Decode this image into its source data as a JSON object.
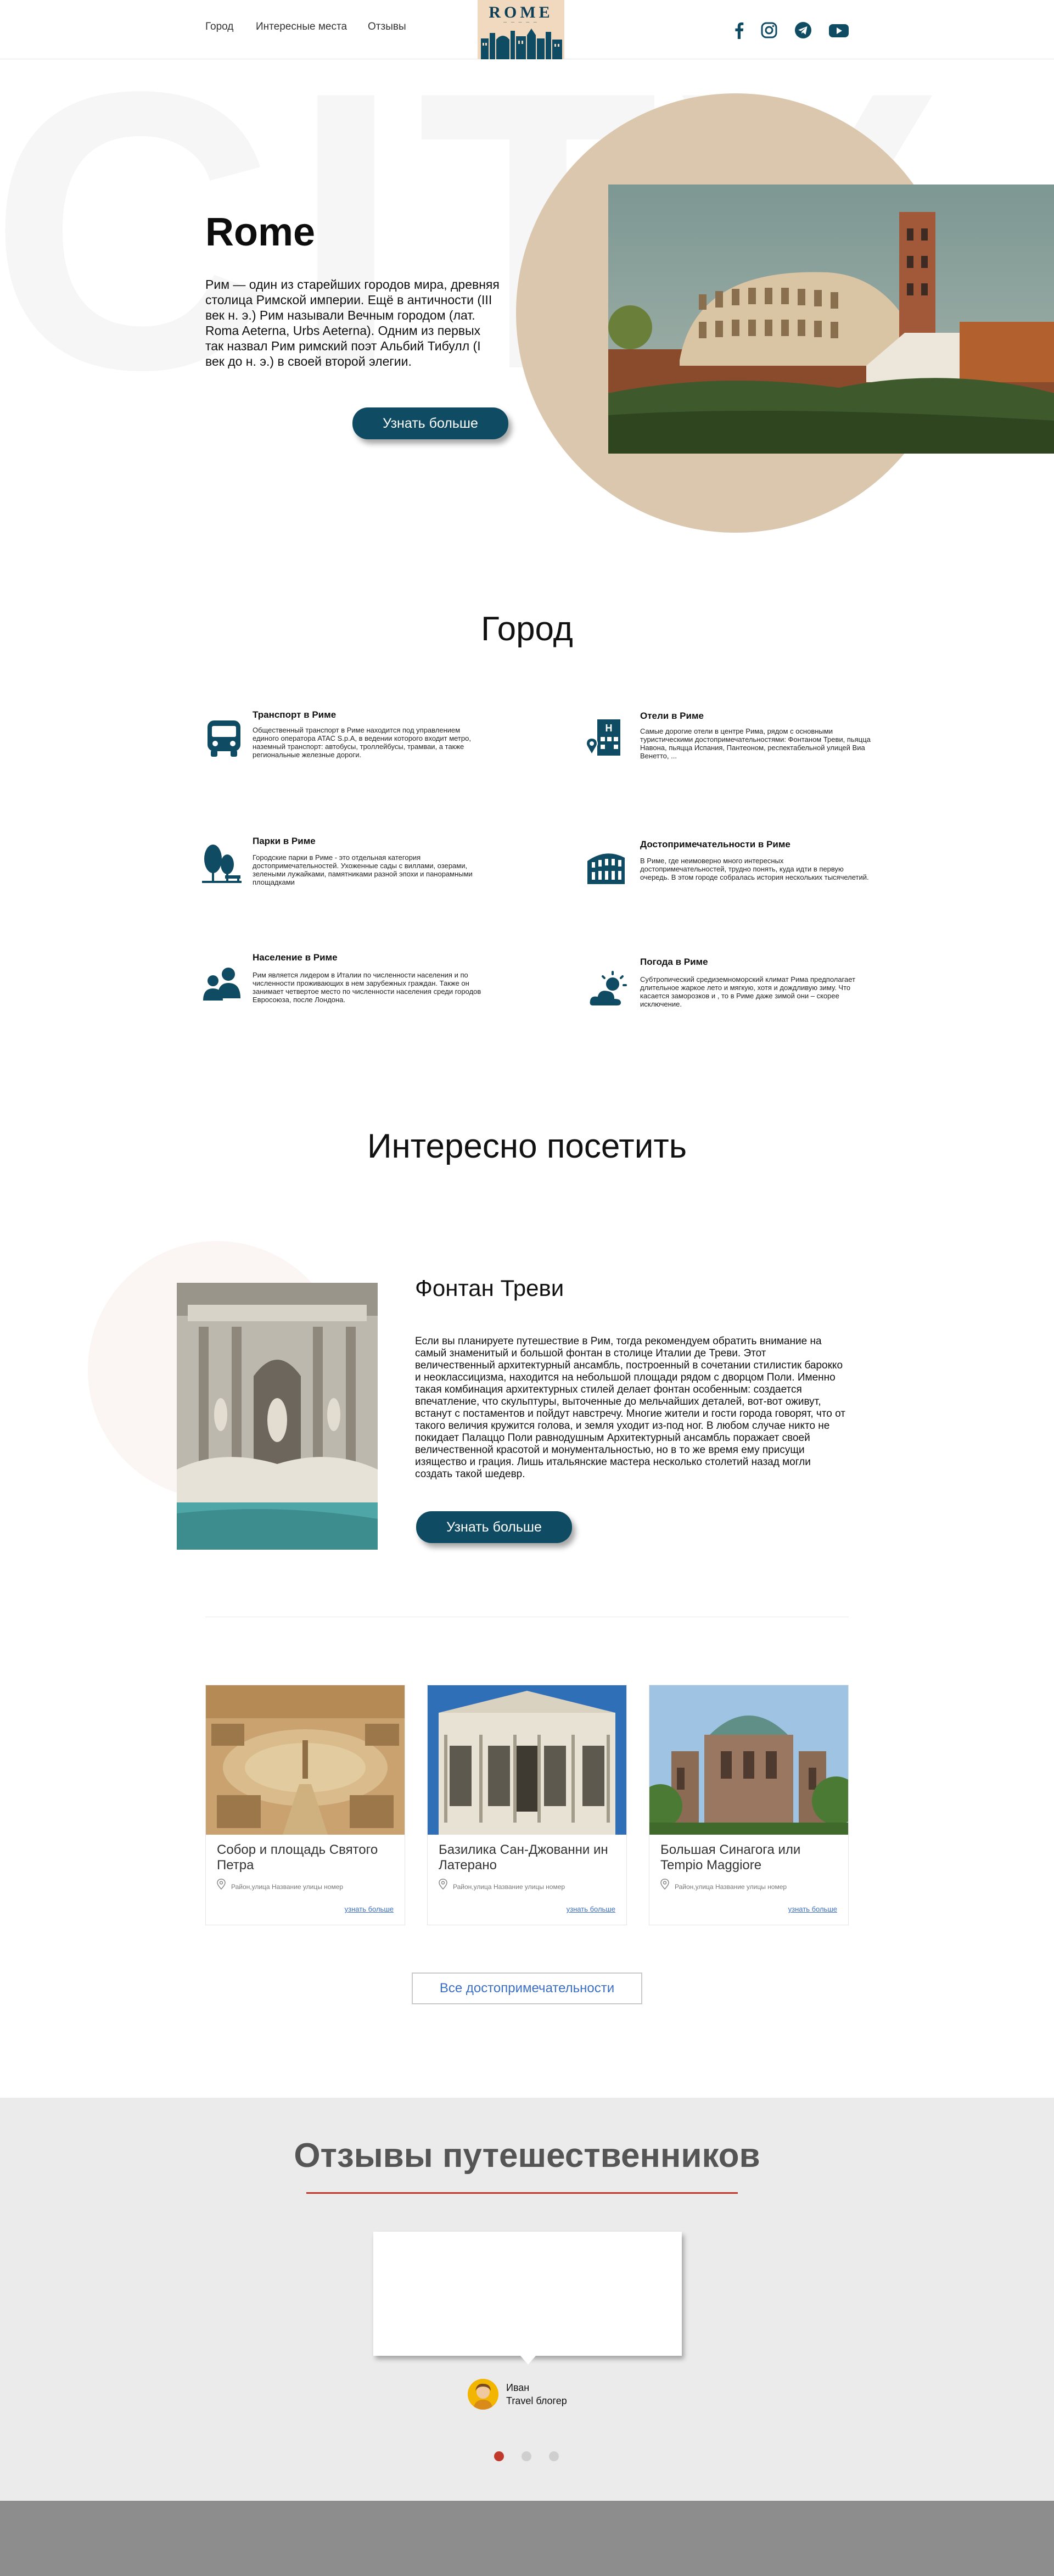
{
  "header": {
    "nav": [
      "Город",
      "Интересные места",
      "Отзывы"
    ],
    "logo_text": "ROME",
    "social_icons": [
      "facebook-icon",
      "instagram-icon",
      "telegram-icon",
      "youtube-icon"
    ]
  },
  "hero": {
    "bg_word": "CITY",
    "title": "Rome",
    "text": "Рим — один из старейших городов мира, древняя столица Римской империи. Ещё в античности (III век н. э.) Рим называли Вечным городом (лат. Roma Aeterna, Urbs Aeterna). Одним из первых так назвал Рим римский поэт Альбий Тибулл (I век до н. э.) в своей второй элегии.",
    "button": "Узнать больше"
  },
  "city": {
    "title": "Город",
    "features": [
      {
        "icon": "bus-icon",
        "title": "Транспорт в Риме",
        "text": "Общественный транспорт в Риме находится под управлением единого оператора ATAC S.p.A, в ведении которого входит метро, наземный транспорт: автобусы, троллейбусы, трамваи, а также региональные железные дороги."
      },
      {
        "icon": "hotel-icon",
        "title": "Отели в Риме",
        "text": "Самые дорогие отели в центре Рима, рядом с основными туристическими достопримечательностями: Фонтаном Треви, пьяцца Навона, пьяцца Испания, Пантеоном, респектабельной улицей Виа Венетто, ..."
      },
      {
        "icon": "park-icon",
        "title": "Парки в Риме",
        "text": "Городские парки в Риме - это отдельная категория достопримечательностей. Ухоженные сады с виллами, озерами, зелеными лужайками, памятниками разной эпохи и панорамными площадками"
      },
      {
        "icon": "colosseum-icon",
        "title": "Достопримечательности в Риме",
        "text": "В Риме, где неимоверно много интересных достопримечательностей, трудно понять, куда идти в первую очередь. В этом городе собралась история нескольких тысячелетий."
      },
      {
        "icon": "people-icon",
        "title": "Население в Риме",
        "text": "Рим является лидером в Италии по численности населения и по численности проживающих в нем зарубежных граждан. Также он занимает четвертое место по численности населения среди городов Евросоюза, после Лондона."
      },
      {
        "icon": "weather-icon",
        "title": "Погода в Риме",
        "text": "Субтропический средиземноморский климат Рима предполагает длительное жаркое лето и мягкую, хотя и дождливую зиму. Что касается заморозков и , то в Риме даже зимой они – скорее исключение."
      }
    ]
  },
  "visit": {
    "title": "Интересно посетить",
    "featured": {
      "title": "Фонтан Треви",
      "text": "Если вы планируете путешествие в Рим, тогда рекомендуем обратить внимание на самый знаменитый и большой фонтан в столице Италии де Треви. Этот величественный архитектурный ансамбль, построенный в сочетании стилистик барокко и неоклассицизма, находится на небольшой площади рядом с дворцом Поли. Именно такая комбинация архитектурных стилей делает фонтан особенным: создается впечатление, что скульптуры, выточенные до мельчайших деталей, вот-вот оживут, встанут с постаментов и пойдут навстречу. Многие жители и гости города говорят, что от такого величия кружится голова, и земля уходит из-под ног. В любом случае никто не покидает Палаццо Поли равнодушным Архитектурный ансамбль поражает своей величественной красотой и монументальностью, но в то же время ему присущи изящество и грация. Лишь итальянские мастера несколько столетий назад могли создать такой шедевр.",
      "button": "Узнать больше"
    },
    "cards": [
      {
        "title": "Собор и площадь Святого Петра",
        "address": "Район,улица Название улицы номер",
        "link": "узнать больше"
      },
      {
        "title": "Базилика Сан-Джованни ин Латерано",
        "address": "Район,улица Название улицы номер",
        "link": "узнать больше"
      },
      {
        "title": "Большая Синагога или Tempio Maggiore",
        "address": "Район,улица Название улицы номер",
        "link": "узнать больше"
      }
    ],
    "all_button": "Все достопримечательности"
  },
  "reviews": {
    "title": "Отзывы путешественников",
    "name": "Иван",
    "role": "Travel блогер",
    "dots": 3,
    "active_dot": 0,
    "accent_color": "#c0392b"
  },
  "colors": {
    "primary": "#0f4c63",
    "beige": "#dac7ae",
    "link": "#3b6fc4"
  }
}
